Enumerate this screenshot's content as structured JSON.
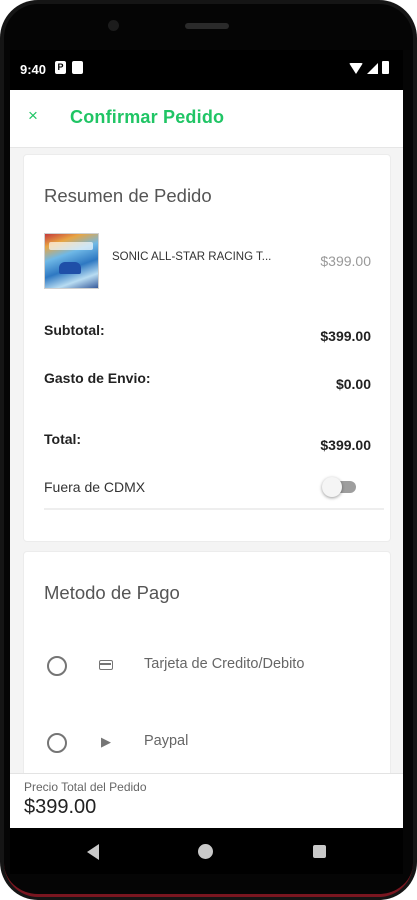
{
  "status_bar": {
    "time": "9:40",
    "notification_icons": [
      "app-notification-icon",
      "sd-card-icon"
    ],
    "system_icons": [
      "wifi-icon",
      "signal-icon",
      "battery-icon"
    ]
  },
  "header": {
    "close_icon": "×",
    "title": "Confirmar Pedido"
  },
  "order_summary": {
    "title": "Resumen de Pedido",
    "product": {
      "name": "SONIC ALL-STAR RACING T...",
      "price": "$399.00"
    },
    "subtotal_label": "Subtotal:",
    "subtotal_value": "$399.00",
    "shipping_label": "Gasto de Envio:",
    "shipping_value": "$0.00",
    "total_label": "Total:",
    "total_value": "$399.00",
    "outside_cdmx_label": "Fuera de CDMX",
    "outside_cdmx_enabled": false
  },
  "payment": {
    "title": "Metodo de Pago",
    "options": [
      {
        "label": "Tarjeta de Credito/Debito",
        "icon": "credit-card-icon",
        "selected": false
      },
      {
        "label": "Paypal",
        "icon": "playstation-icon",
        "selected": false
      }
    ]
  },
  "footer": {
    "label": "Precio Total del Pedido",
    "total": "$399.00"
  },
  "colors": {
    "accent": "#20c565",
    "toggle_off": "#9e9e9e",
    "device_accent": "#7a1620"
  }
}
